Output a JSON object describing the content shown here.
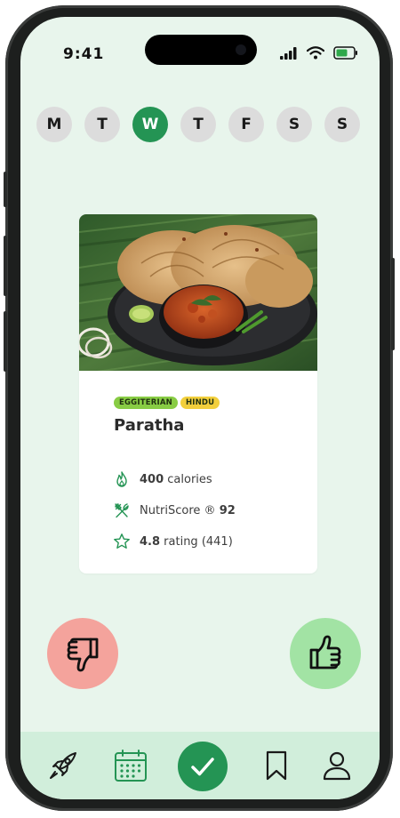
{
  "status": {
    "time": "9:41"
  },
  "days": [
    "M",
    "T",
    "W",
    "T",
    "F",
    "S",
    "S"
  ],
  "active_day_index": 2,
  "meal": {
    "tags": [
      "EGGITERIAN",
      "HINDU"
    ],
    "name": "Paratha",
    "calories_value": "400",
    "calories_label": "calories",
    "nutriscore_label": "NutriScore ®",
    "nutriscore_value": "92",
    "rating_value": "4.8",
    "rating_label": "rating (441)"
  },
  "colors": {
    "background": "#e8f5ec",
    "accent": "#249454",
    "dislike": "#f4a39c",
    "like": "#a2e3a4",
    "tag_green": "#88cc44",
    "tag_yellow": "#f2cf3c",
    "tabbar": "#d1eedb"
  },
  "icons": {
    "dislike": "thumbs-down-icon",
    "like": "thumbs-up-icon",
    "tabs": [
      "rocket-icon",
      "calendar-icon",
      "checkmark-icon",
      "bookmark-icon",
      "user-icon"
    ]
  }
}
